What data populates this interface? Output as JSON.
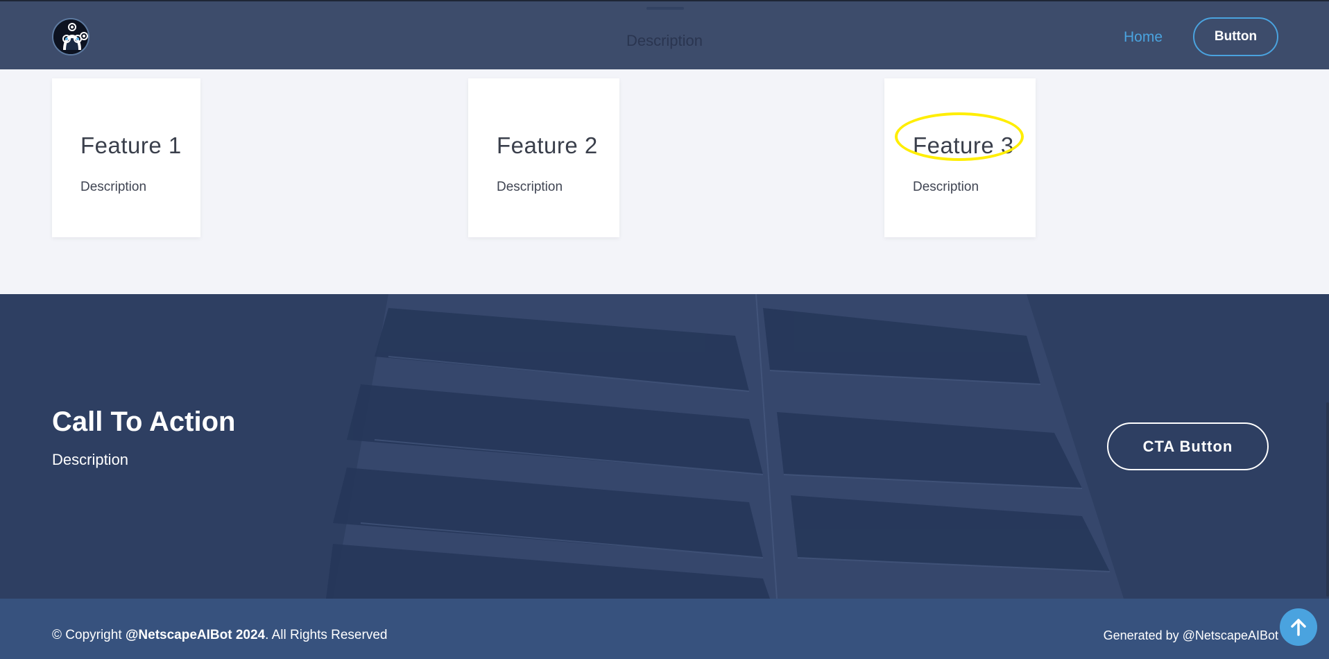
{
  "header": {
    "description": "Description",
    "nav_home": "Home",
    "button_label": "Button",
    "logo_icon": "robot-logo-icon"
  },
  "features": [
    {
      "title": "Feature 1",
      "description": "Description"
    },
    {
      "title": "Feature 2",
      "description": "Description"
    },
    {
      "title": "Feature 3",
      "description": "Description"
    }
  ],
  "cta": {
    "title": "Call To Action",
    "description": "Description",
    "button_label": "CTA Button"
  },
  "footer": {
    "copyright_prefix": "© Copyright ",
    "copyright_brand": "@NetscapeAIBot 2024",
    "copyright_suffix": ". All Rights Reserved",
    "generated_by": "Generated by @NetscapeAIBot",
    "scroll_top_icon": "arrow-up-icon"
  },
  "colors": {
    "header_bg": "#3d4c6b",
    "accent": "#4aa3df",
    "cta_bg": "#2e3f62",
    "footer_bg": "#37527e",
    "highlight": "#ffee00"
  }
}
